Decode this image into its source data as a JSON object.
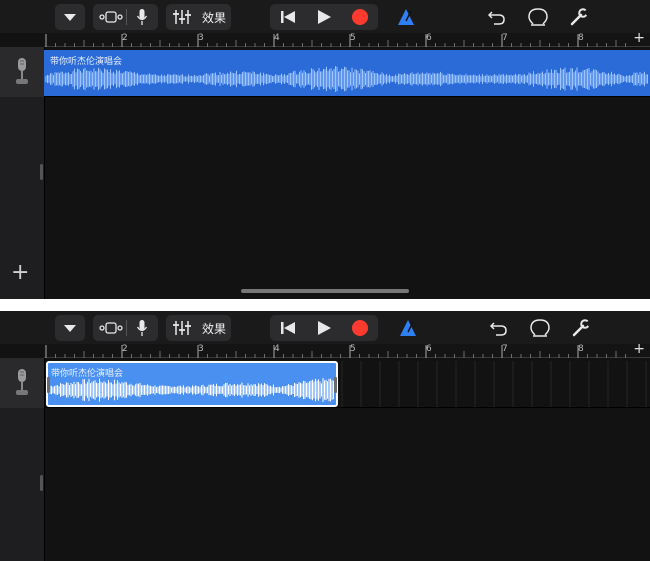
{
  "toolbar": {
    "effects_label": "效果",
    "icons": [
      "dropdown-icon",
      "track-view-icon",
      "microphone-icon",
      "mixer-icon",
      "rewind-icon",
      "play-icon",
      "record-icon",
      "metronome-icon",
      "undo-icon",
      "loop-icon",
      "settings-wrench-icon"
    ]
  },
  "ruler": {
    "bars": [
      "2",
      "3",
      "4",
      "5",
      "6",
      "7",
      "8"
    ],
    "add_label": "+"
  },
  "track": {
    "instrument_icon": "microphone-icon",
    "region_name": "带你听杰伦演唱会"
  },
  "sidebar": {
    "add_track_label": "+"
  },
  "colors": {
    "region_top": "#2a6bd8",
    "region_bottom_selected": "#4a90f0",
    "record": "#ff3b30",
    "metronome": "#2f7ff5",
    "background": "#121212"
  }
}
